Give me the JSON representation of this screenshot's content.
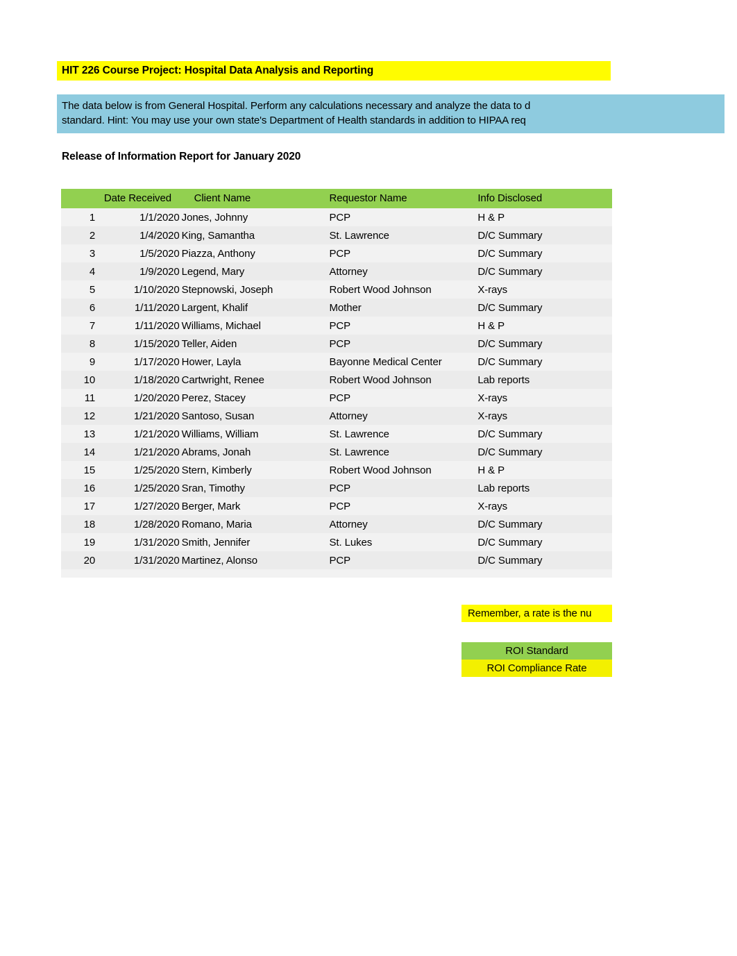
{
  "title_banner": {
    "text": "HIT 226 Course Project: Hospital Data Analysis and Reporting",
    "background": "#fffc00"
  },
  "instructions": {
    "line1": "The data below is from General Hospital.  Perform any calculations necessary and analyze the data to d",
    "line2": "standard.  Hint: You may use your own state's Department of Health standards in addition to HIPAA req",
    "background": "#8ecbdf"
  },
  "report": {
    "subtitle": "Release of Information Report for January 2020",
    "header_background": "#92d050",
    "columns": [
      "",
      "Date Received",
      "Client Name",
      "Requestor Name",
      "Info Disclosed"
    ],
    "rows": [
      {
        "num": "1",
        "date": "1/1/2020",
        "client": "Jones, Johnny",
        "requestor": "PCP",
        "info": "H & P"
      },
      {
        "num": "2",
        "date": "1/4/2020",
        "client": "King, Samantha",
        "requestor": "St. Lawrence",
        "info": "D/C Summary"
      },
      {
        "num": "3",
        "date": "1/5/2020",
        "client": "Piazza, Anthony",
        "requestor": "PCP",
        "info": "D/C Summary"
      },
      {
        "num": "4",
        "date": "1/9/2020",
        "client": "Legend, Mary",
        "requestor": "Attorney",
        "info": "D/C Summary"
      },
      {
        "num": "5",
        "date": "1/10/2020",
        "client": "Stepnowski, Joseph",
        "requestor": "Robert Wood Johnson",
        "info": "X-rays"
      },
      {
        "num": "6",
        "date": "1/11/2020",
        "client": "Largent, Khalif",
        "requestor": "Mother",
        "info": "D/C Summary"
      },
      {
        "num": "7",
        "date": "1/11/2020",
        "client": "Williams, Michael",
        "requestor": "PCP",
        "info": "H & P"
      },
      {
        "num": "8",
        "date": "1/15/2020",
        "client": "Teller, Aiden",
        "requestor": "PCP",
        "info": "D/C Summary"
      },
      {
        "num": "9",
        "date": "1/17/2020",
        "client": "Hower, Layla",
        "requestor": "Bayonne Medical Center",
        "info": "D/C Summary"
      },
      {
        "num": "10",
        "date": "1/18/2020",
        "client": "Cartwright, Renee",
        "requestor": "Robert Wood Johnson",
        "info": "Lab reports"
      },
      {
        "num": "11",
        "date": "1/20/2020",
        "client": "Perez, Stacey",
        "requestor": "PCP",
        "info": "X-rays"
      },
      {
        "num": "12",
        "date": "1/21/2020",
        "client": "Santoso, Susan",
        "requestor": "Attorney",
        "info": "X-rays"
      },
      {
        "num": "13",
        "date": "1/21/2020",
        "client": "Williams, William",
        "requestor": "St. Lawrence",
        "info": "D/C Summary"
      },
      {
        "num": "14",
        "date": "1/21/2020",
        "client": "Abrams, Jonah",
        "requestor": "St. Lawrence",
        "info": "D/C Summary"
      },
      {
        "num": "15",
        "date": "1/25/2020",
        "client": "Stern, Kimberly",
        "requestor": "Robert Wood Johnson",
        "info": "H & P"
      },
      {
        "num": "16",
        "date": "1/25/2020",
        "client": "Sran, Timothy",
        "requestor": "PCP",
        "info": "Lab reports"
      },
      {
        "num": "17",
        "date": "1/27/2020",
        "client": "Berger, Mark",
        "requestor": "PCP",
        "info": "X-rays"
      },
      {
        "num": "18",
        "date": "1/28/2020",
        "client": "Romano, Maria",
        "requestor": "Attorney",
        "info": "D/C Summary"
      },
      {
        "num": "19",
        "date": "1/31/2020",
        "client": "Smith, Jennifer",
        "requestor": "St. Lukes",
        "info": "D/C Summary"
      },
      {
        "num": "20",
        "date": "1/31/2020",
        "client": "Martinez, Alonso",
        "requestor": "PCP",
        "info": "D/C Summary"
      }
    ]
  },
  "notes": {
    "remember": "Remember, a rate is the nu"
  },
  "roi_metrics": {
    "standard_label": "ROI Standard",
    "standard_value": "",
    "compliance_label": "ROI Compliance Rate",
    "compliance_value": "",
    "standard_background": "#92d050",
    "compliance_background": "#f3f000"
  }
}
